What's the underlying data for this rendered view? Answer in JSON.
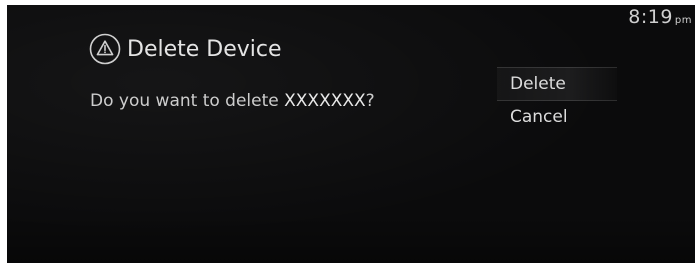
{
  "status_bar": {
    "time": "8:19",
    "time_suffix": "pm"
  },
  "dialog": {
    "icon": "warning-triangle-icon",
    "title": "Delete Device",
    "message_prefix": "Do you want to delete ",
    "device_name": "XXXXXXX",
    "message_suffix": "?",
    "options": [
      {
        "label": "Delete",
        "selected": true
      },
      {
        "label": "Cancel",
        "selected": false
      }
    ]
  },
  "colors": {
    "background": "#0b0b0c",
    "text": "#dcdcdc",
    "frame": "#ffffff"
  }
}
